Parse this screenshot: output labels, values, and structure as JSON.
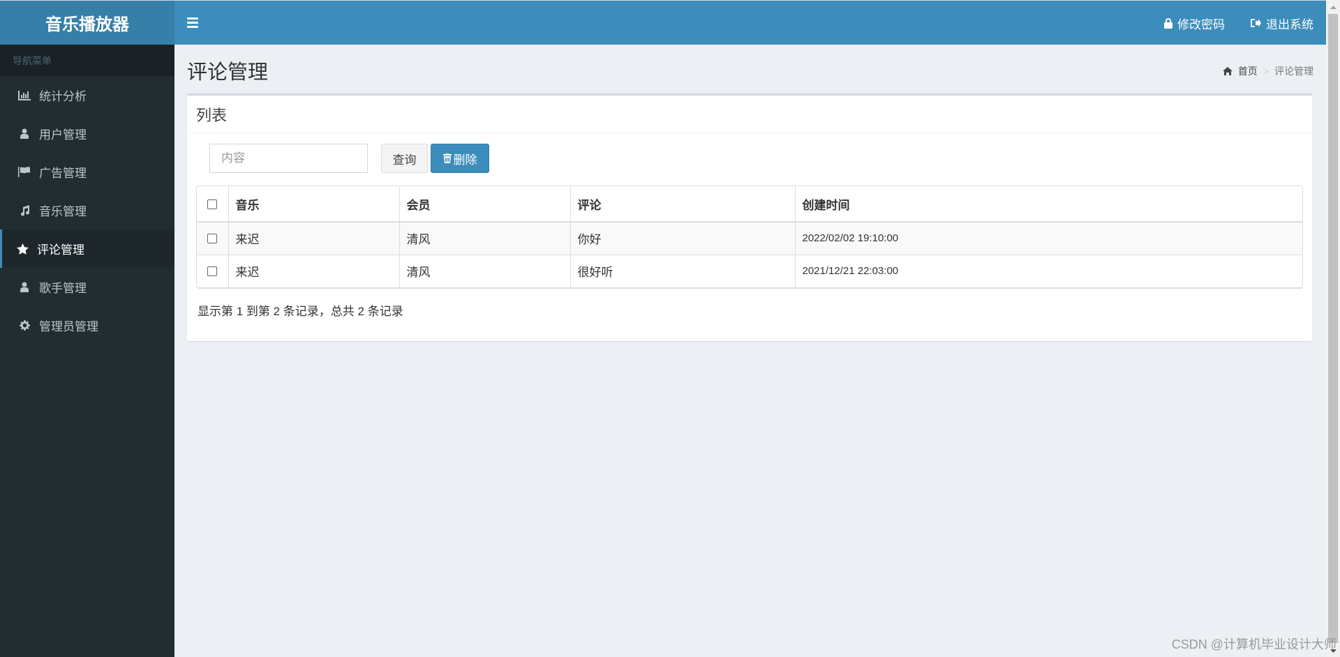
{
  "app": {
    "title": "音乐播放器"
  },
  "navbar": {
    "change_password": "修改密码",
    "logout": "退出系统"
  },
  "sidebar": {
    "header": "导航菜单",
    "items": [
      {
        "label": "统计分析",
        "icon": "bar-chart-icon",
        "active": false
      },
      {
        "label": "用户管理",
        "icon": "user-icon",
        "active": false
      },
      {
        "label": "广告管理",
        "icon": "flag-icon",
        "active": false
      },
      {
        "label": "音乐管理",
        "icon": "music-icon",
        "active": false
      },
      {
        "label": "评论管理",
        "icon": "star-icon",
        "active": true
      },
      {
        "label": "歌手管理",
        "icon": "user-icon",
        "active": false
      },
      {
        "label": "管理员管理",
        "icon": "gear-icon",
        "active": false
      }
    ]
  },
  "page": {
    "title": "评论管理",
    "breadcrumb": {
      "home": "首页",
      "separator": ">",
      "current": "评论管理"
    }
  },
  "box": {
    "title": "列表",
    "search": {
      "value": "",
      "placeholder": "内容"
    },
    "query_label": "查询",
    "delete_label": "删除"
  },
  "table": {
    "columns": [
      "音乐",
      "会员",
      "评论",
      "创建时间"
    ],
    "rows": [
      {
        "music": "来迟",
        "member": "清风",
        "comment": "你好",
        "created": "2022/02/02 19:10:00",
        "checked": false
      },
      {
        "music": "来迟",
        "member": "清风",
        "comment": "很好听",
        "created": "2021/12/21 22:03:00",
        "checked": false
      }
    ]
  },
  "pagination": {
    "info": "显示第 1 到第 2 条记录，总共 2 条记录"
  },
  "watermark": "CSDN @计算机毕业设计大师",
  "colors": {
    "primary": "#3c8dbc",
    "logo_bg": "#367fa9",
    "sidebar_bg": "#222d32",
    "content_bg": "#ecf0f5"
  }
}
